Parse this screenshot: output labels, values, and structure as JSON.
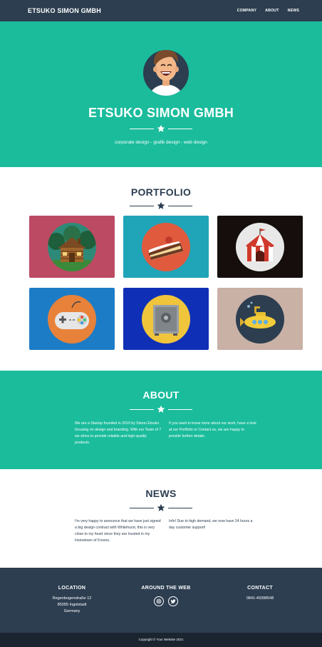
{
  "nav": {
    "brand": "ETSUKO SIMON GMBH",
    "links": [
      "COMPANY",
      "ABOUT",
      "NEWS"
    ]
  },
  "hero": {
    "title": "ETSUKO SIMON GMBH",
    "subtitle": "corporate design - grafik design - web design"
  },
  "portfolio": {
    "title": "PORTFOLIO",
    "items": [
      {
        "icon": "cabin-icon",
        "bg": "#bd4a63"
      },
      {
        "icon": "cake-icon",
        "bg": "#20a4b8"
      },
      {
        "icon": "circus-tent-icon",
        "bg": "#150e0d"
      },
      {
        "icon": "game-controller-icon",
        "bg": "#1d7cc6"
      },
      {
        "icon": "safe-icon",
        "bg": "#0f30b6"
      },
      {
        "icon": "submarine-icon",
        "bg": "#c9b1a5"
      }
    ]
  },
  "about": {
    "title": "ABOUT",
    "left": "We are a Startup founded in 2019 by Simon Etsuko focusing on design and branding. With our Team of 7 we strive to provide reliable and high-quality products.",
    "right": "If you want to know more about our work, have a look at our Portfolio or Contact us, we are happy to provide further details."
  },
  "news": {
    "title": "NEWS",
    "left": "I'm very happy to announce that we have just signed a big design contract with Whitehurst, this is very close to my heart since they are located in my Hometown of Fresno.",
    "right": "Info! Due to high demand, we now have 24 hours a day customer support!"
  },
  "footer": {
    "location_title": "LOCATION",
    "location_lines": [
      "Regenbogenstraße 12",
      "85055 Ingolstadt",
      "Germany"
    ],
    "web_title": "AROUND THE WEB",
    "contact_title": "CONTACT",
    "phone": "0841-49398548",
    "copyright": "Copyright © Your Website 2021"
  },
  "colors": {
    "primary": "#1abc9c",
    "dark": "#2c3e50",
    "darker": "#1a252f"
  }
}
